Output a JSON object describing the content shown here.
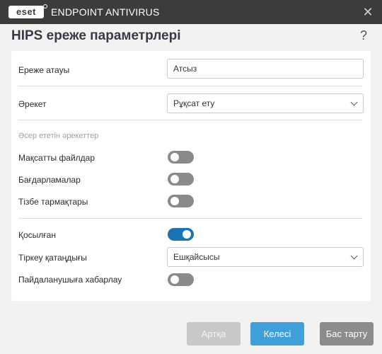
{
  "titlebar": {
    "logo": "eset",
    "app_name": "ENDPOINT ANTIVIRUS",
    "close": "✕"
  },
  "header": {
    "title": "HIPS ереже параметрлері",
    "help": "?"
  },
  "form": {
    "rule_name": {
      "label": "Ереже атауы",
      "value": "Атсыз"
    },
    "action": {
      "label": "Әрекет",
      "value": "Рұқсат ету"
    },
    "affected_section": "Әсер ететін әрекеттер",
    "target_files": {
      "label": "Мақсатты файлдар",
      "enabled": false
    },
    "applications": {
      "label": "Бағдарламалар",
      "enabled": false
    },
    "registry_entries": {
      "label": "Тізбе тармақтары",
      "enabled": false
    },
    "enabled": {
      "label": "Қосылған",
      "enabled": true
    },
    "log_severity": {
      "label": "Тіркеу қатаңдығы",
      "value": "Ешқайсысы"
    },
    "notify_user": {
      "label": "Пайдаланушыға хабарлау",
      "enabled": false
    }
  },
  "footer": {
    "back": "Артқа",
    "next": "Келесі",
    "cancel": "Бас тарту"
  },
  "colors": {
    "accent": "#1c73b4",
    "titlebar": "#3c3c3c",
    "next_button": "#3f9fd8"
  }
}
